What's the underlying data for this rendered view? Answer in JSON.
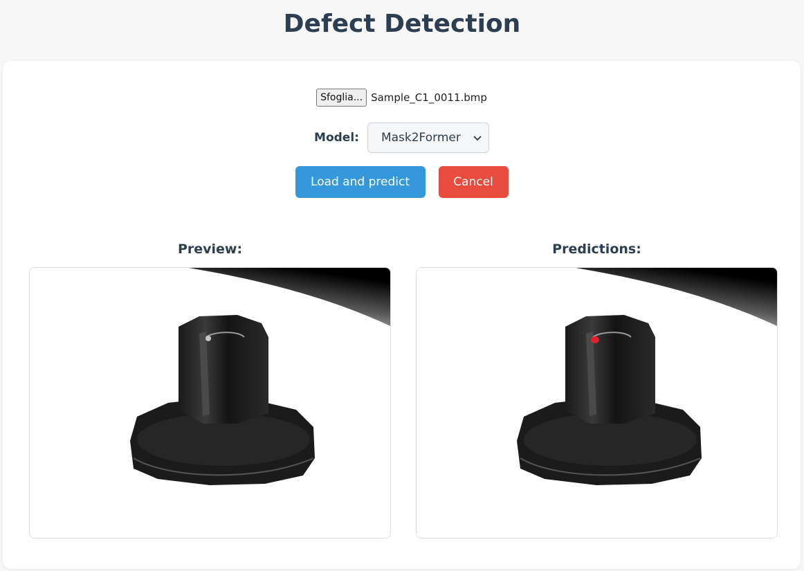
{
  "page": {
    "title": "Defect Detection"
  },
  "upload": {
    "browse_label": "Sfoglia...",
    "file_name": "Sample_C1_0011.bmp"
  },
  "model": {
    "label": "Model:",
    "selected": "Mask2Former"
  },
  "actions": {
    "predict_label": "Load and predict",
    "cancel_label": "Cancel"
  },
  "preview": {
    "title": "Preview:"
  },
  "predictions": {
    "title": "Predictions:",
    "defect_color": "#e0202a"
  },
  "colors": {
    "primary": "#3498db",
    "danger": "#e74c3c",
    "text": "#2c3e50"
  },
  "icons": {
    "select_arrow": "chevron-down-icon"
  }
}
